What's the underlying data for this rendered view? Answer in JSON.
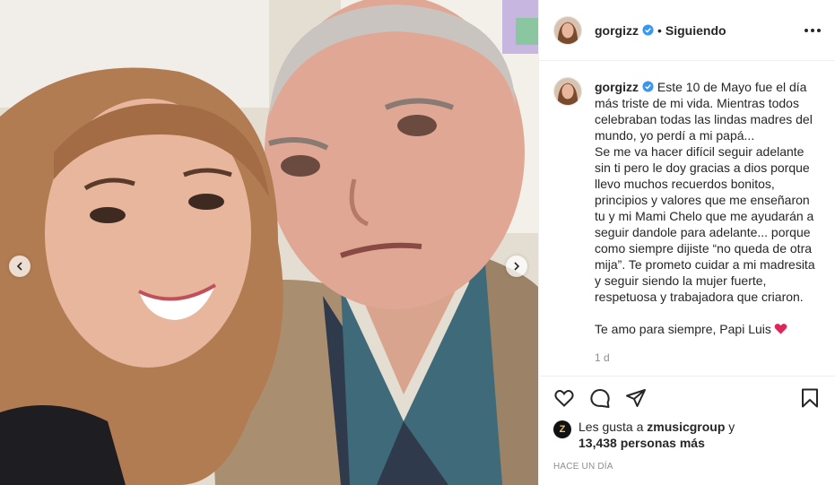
{
  "post": {
    "username": "gorgizz",
    "follow_status": "Siguiendo",
    "dot": "•",
    "caption": "Este 10 de Mayo fue el día más triste de mi vida. Mientras todos celebraban todas las lindas madres del mundo, yo perdí a mi papá...\nSe me va hacer difícil seguir adelante sin ti pero le doy gracias a dios porque llevo muchos recuerdos bonitos, principios y valores que me enseñaron tu y mi Mami Chelo que me ayudarán a seguir dandole para adelante... porque como siempre dijiste “no queda de otra mija”. Te prometo cuidar a mi madresita y seguir siendo la mujer fuerte, respetuosa y trabajadora que criaron.",
    "caption_end": "Te amo para siempre, Papi Luis",
    "comment_time": "1 d",
    "likes_prefix": "Les gusta a",
    "likes_user": "zmusicgroup",
    "likes_and": "y",
    "likes_count": "13,438 personas más",
    "posted_ago": "HACE UN DÍA",
    "liked_by_avatar_glyph": "Z"
  },
  "icons": {
    "more": "more-options-icon",
    "verified": "verified-badge-icon",
    "like": "heart-icon",
    "comment": "comment-bubble-icon",
    "share": "paper-plane-icon",
    "save": "bookmark-icon",
    "prev": "chevron-left-icon",
    "next": "chevron-right-icon"
  },
  "colors": {
    "verified": "#3897f0",
    "heart_emoji": "#e0245e",
    "secondary_text": "#8e8e8e",
    "border": "#efefef"
  }
}
